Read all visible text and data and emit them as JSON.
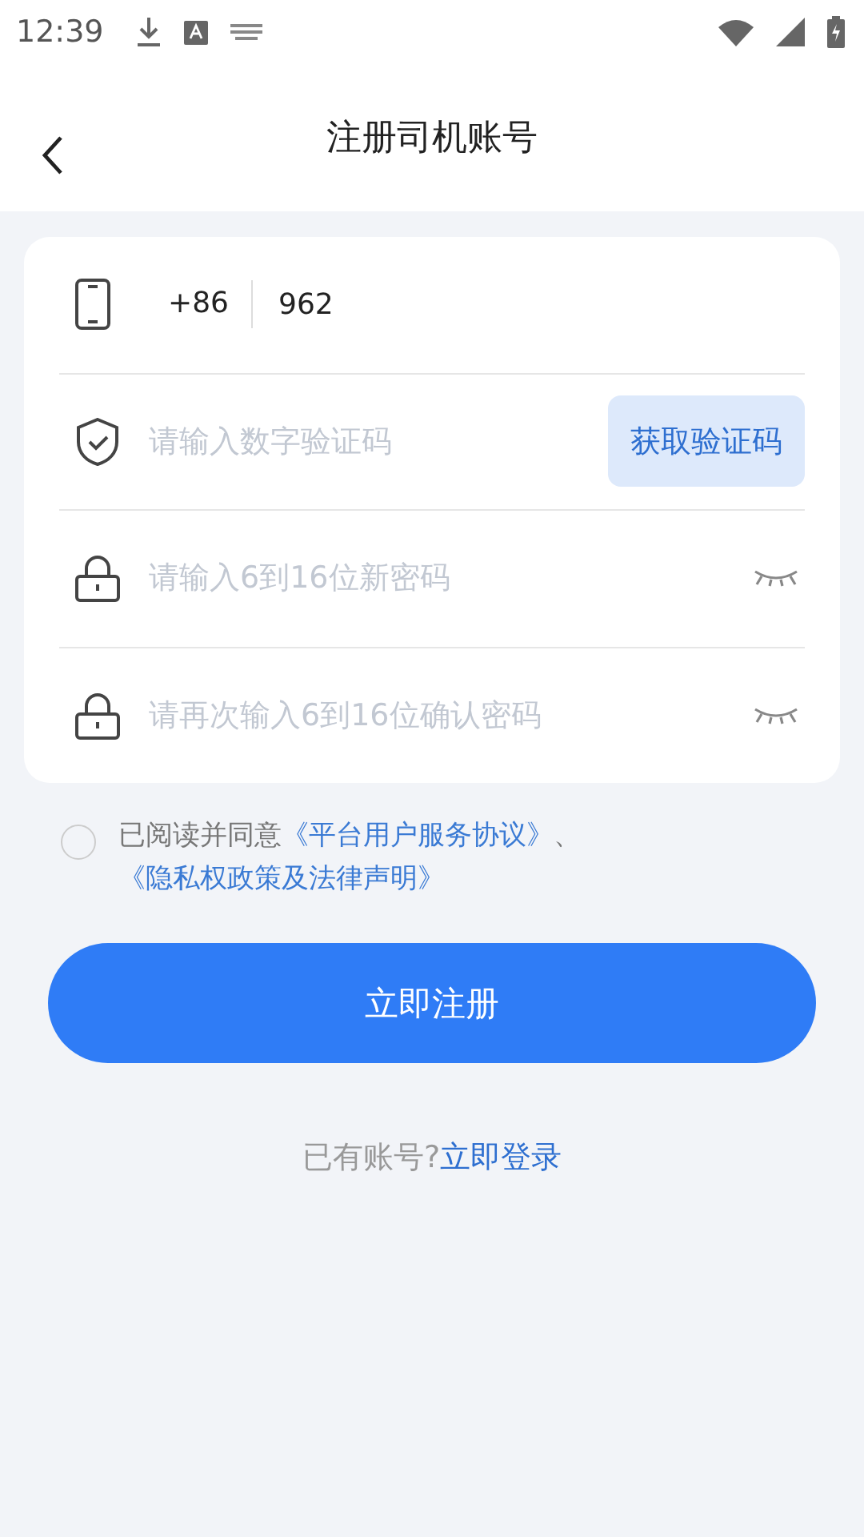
{
  "status_bar": {
    "time": "12:39"
  },
  "header": {
    "title": "注册司机账号"
  },
  "form": {
    "phone": {
      "country_code": "+86",
      "value": "962"
    },
    "fields": [
      {
        "kind": "code",
        "placeholder": "请输入数字验证码",
        "button": "获取验证码"
      },
      {
        "kind": "password",
        "placeholder": "请输入6到16位新密码"
      },
      {
        "kind": "password",
        "placeholder": "请再次输入6到16位确认密码"
      }
    ]
  },
  "agreement": {
    "checked": false,
    "text": "已阅读并同意",
    "link_1": "《平台用户服务协议》",
    "separator": "、",
    "link_2": "《隐私权政策及法律声明》"
  },
  "register_button": "立即注册",
  "login": {
    "prompt": "已有账号?",
    "link": "立即登录"
  }
}
